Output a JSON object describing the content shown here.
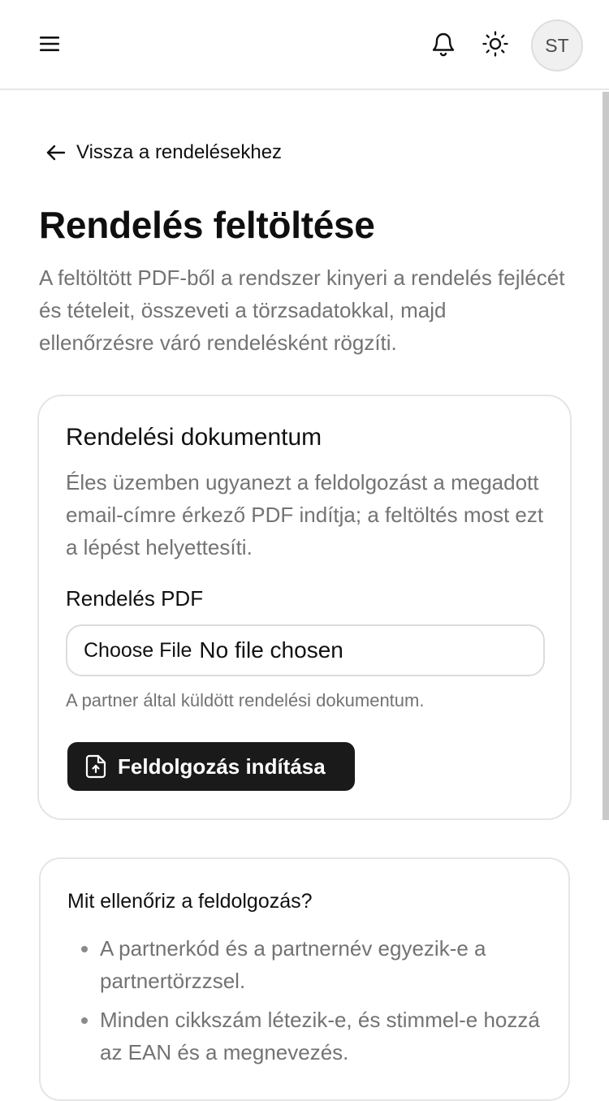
{
  "header": {
    "menu_icon": "hamburger-menu-icon",
    "bell_icon": "bell-icon",
    "theme_icon": "sun-icon",
    "avatar_initials": "ST"
  },
  "back_link": {
    "label": "Vissza a rendelésekhez",
    "icon": "arrow-left-icon"
  },
  "page": {
    "title": "Rendelés feltöltése",
    "description": "A feltöltött PDF-ből a rendszer kinyeri a rendelés fejlécét és tételeit, összeveti a törzsadatokkal, majd ellenőrzésre váró rendelésként rögzíti."
  },
  "upload_card": {
    "title": "Rendelési dokumentum",
    "description": "Éles üzemben ugyanezt a feldolgozást a megadott email-címre érkező PDF indítja; a feltöltés most ezt a lépést helyettesíti.",
    "field_label": "Rendelés PDF",
    "choose_file_label": "Choose File",
    "no_file_text": "No file chosen",
    "field_hint": "A partner által küldött rendelési dokumentum.",
    "submit_label": "Feldolgozás indítása",
    "submit_icon": "file-upload-icon"
  },
  "info_card": {
    "title": "Mit ellenőriz a feldolgozás?",
    "items": [
      "A partnerkód és a partnernév egyezik-e a partnertörzzsel.",
      "Minden cikkszám létezik-e, és stimmel-e hozzá az EAN és a megnevezés."
    ]
  },
  "colors": {
    "primary_button": "#1a1a1a",
    "muted_text": "#737373",
    "border": "#e5e5e5"
  }
}
